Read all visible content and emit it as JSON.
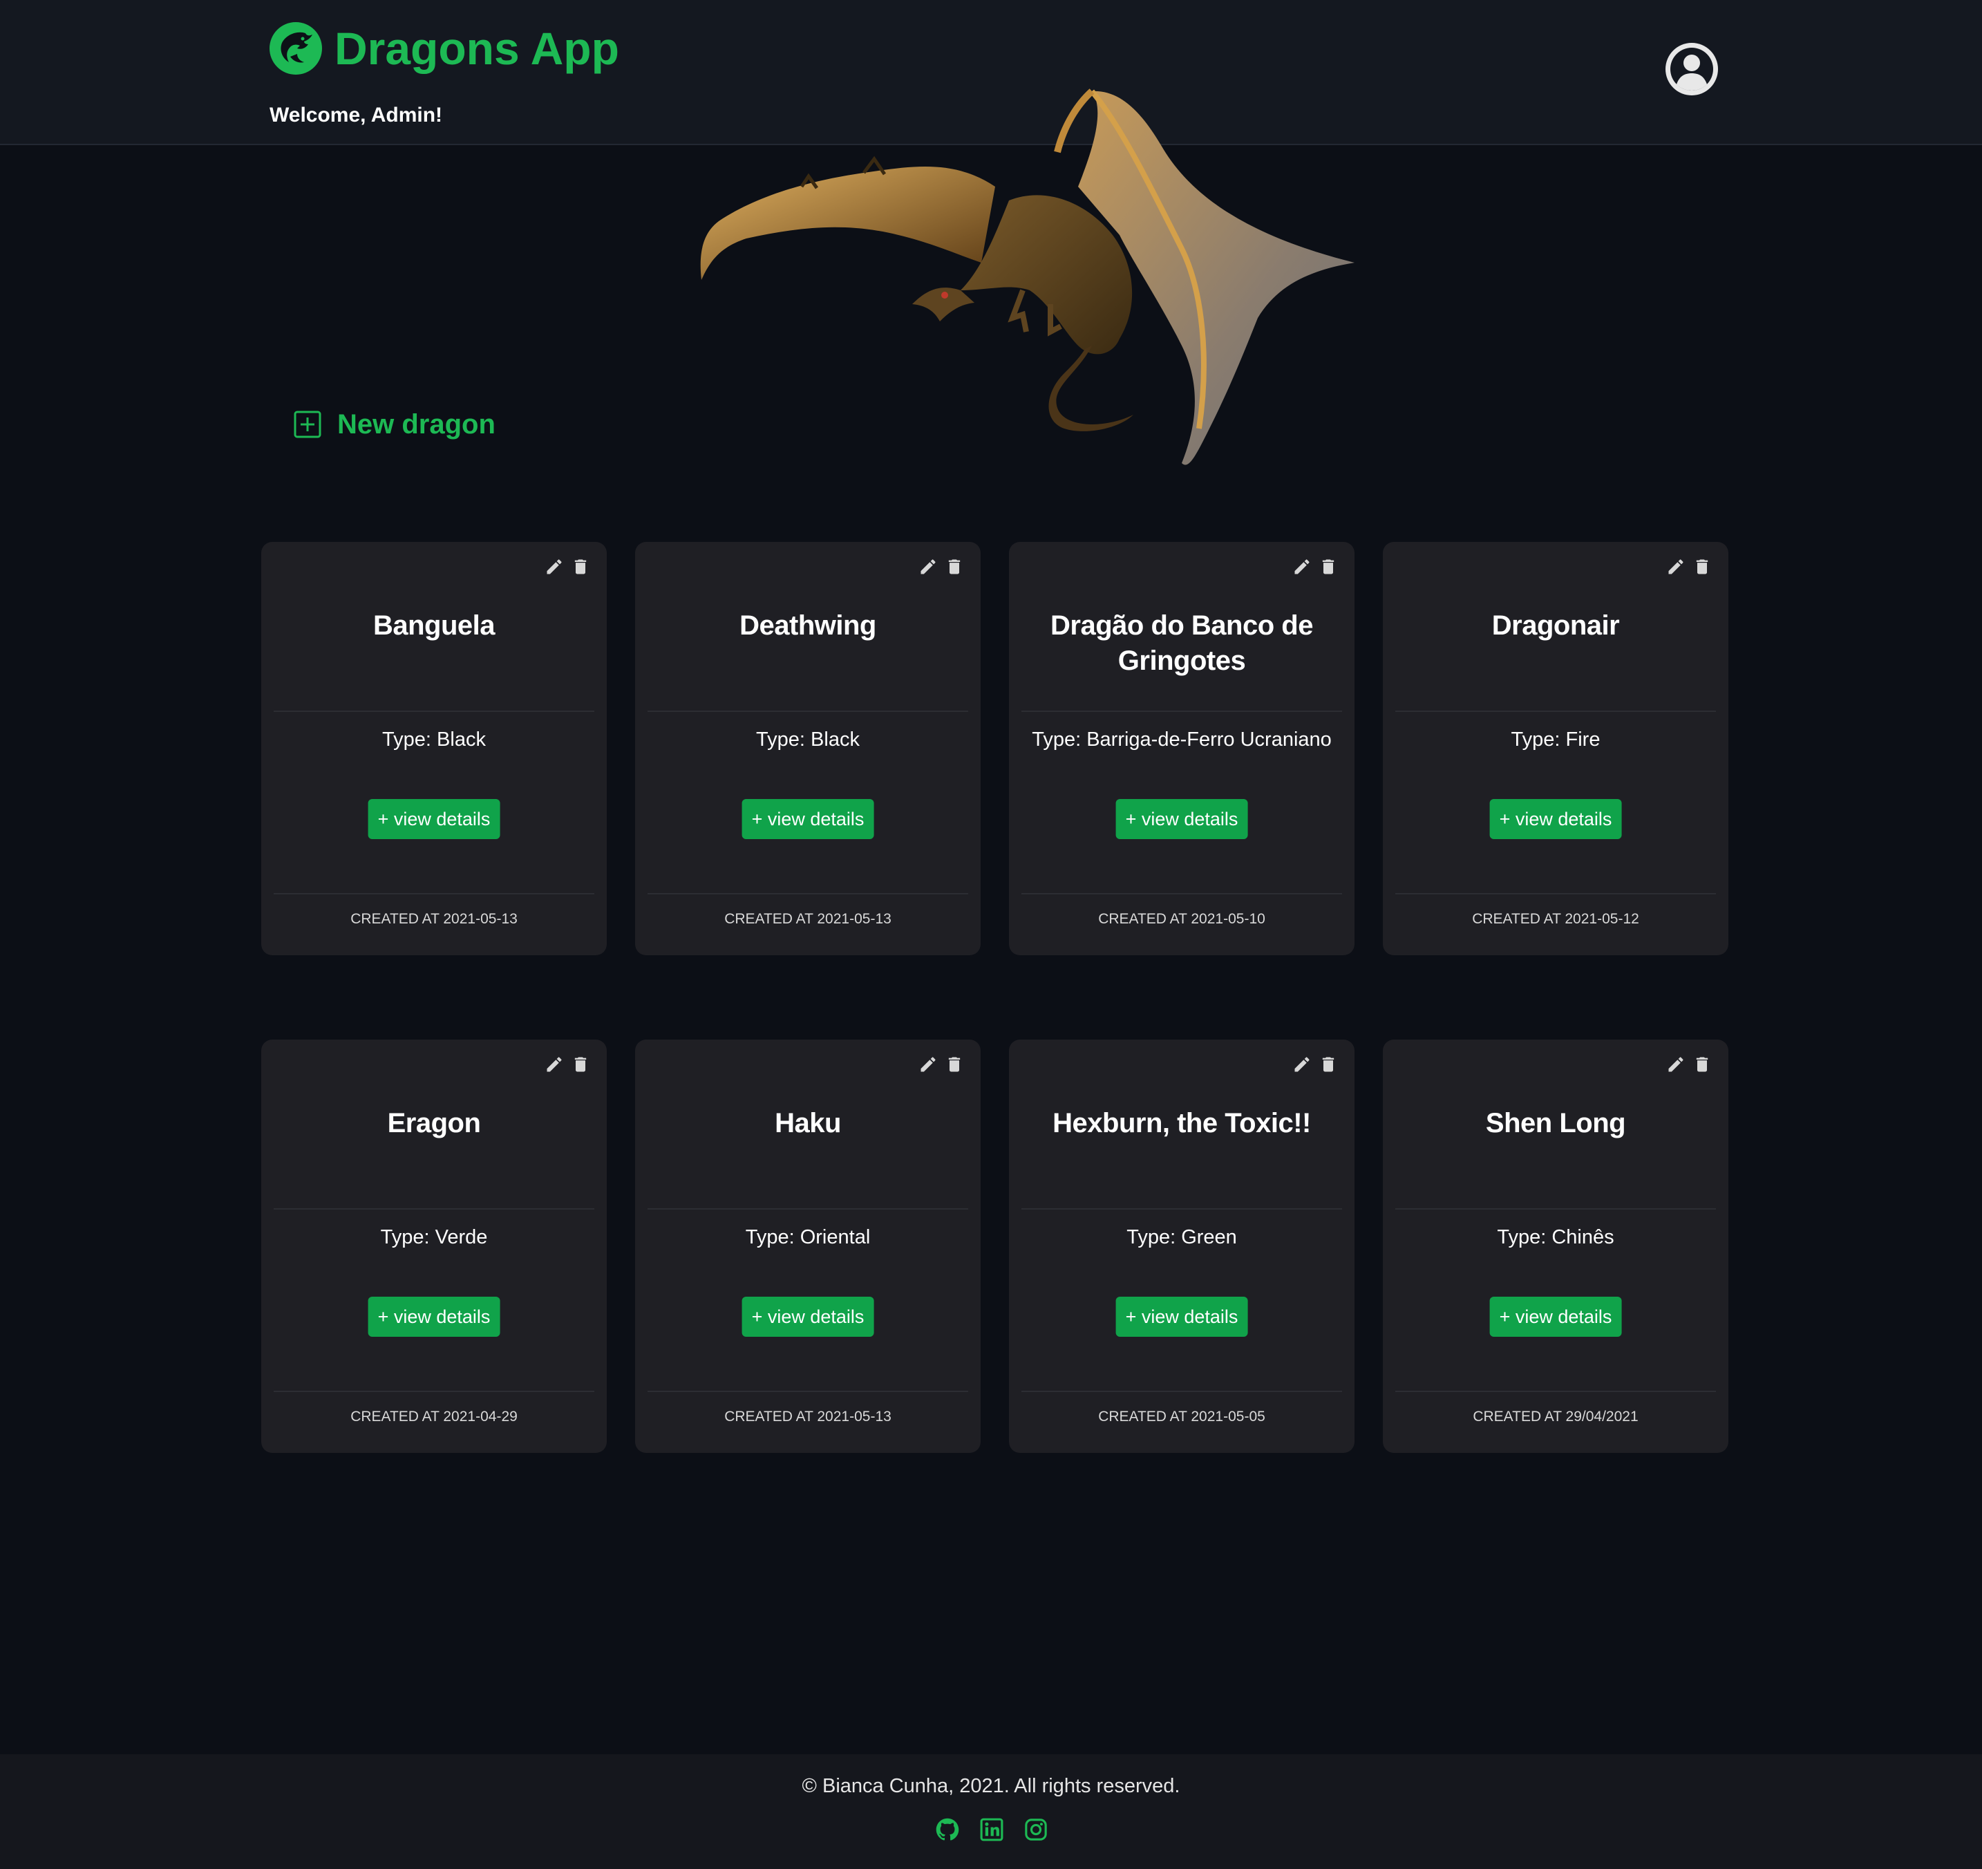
{
  "header": {
    "app_title": "Dragons App",
    "welcome": "Welcome, Admin!"
  },
  "actions": {
    "new_dragon_label": "New dragon"
  },
  "dragons": [
    {
      "name": "Banguela",
      "type": "Type: Black",
      "button": "+ view details",
      "created": "CREATED AT 2021-05-13"
    },
    {
      "name": "Deathwing",
      "type": "Type: Black",
      "button": "+ view details",
      "created": "CREATED AT 2021-05-13"
    },
    {
      "name": "Dragão do Banco de Gringotes",
      "type": "Type: Barriga-de-Ferro Ucraniano",
      "button": "+ view details",
      "created": "CREATED AT 2021-05-10"
    },
    {
      "name": "Dragonair",
      "type": "Type: Fire",
      "button": "+ view details",
      "created": "CREATED AT 2021-05-12"
    },
    {
      "name": "Eragon",
      "type": "Type: Verde",
      "button": "+ view details",
      "created": "CREATED AT 2021-04-29"
    },
    {
      "name": "Haku",
      "type": "Type: Oriental",
      "button": "+ view details",
      "created": "CREATED AT 2021-05-13"
    },
    {
      "name": "Hexburn, the Toxic!!",
      "type": "Type: Green",
      "button": "+ view details",
      "created": "CREATED AT 2021-05-05"
    },
    {
      "name": "Shen Long",
      "type": "Type: Chinês",
      "button": "+ view details",
      "created": "CREATED AT 29/04/2021"
    }
  ],
  "footer": {
    "copyright": "© Bianca Cunha, 2021. All rights reserved.",
    "social_icons": [
      "github-icon",
      "linkedin-icon",
      "instagram-icon"
    ]
  },
  "colors": {
    "accent": "#1db954",
    "button": "#10a34a",
    "background": "#0c0f16",
    "header": "#141820",
    "card": "#1f1f24"
  }
}
